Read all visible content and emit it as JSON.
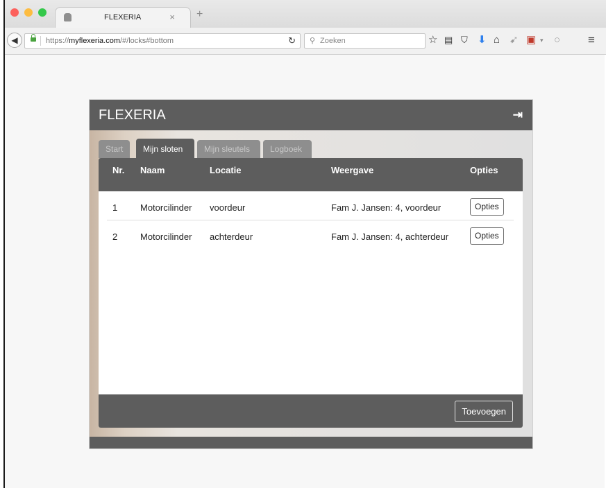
{
  "browser": {
    "tab_title": "FLEXERIA",
    "tab_close": "×",
    "new_tab": "+",
    "url_prefix": "https://",
    "url_domain": "myflexeria.com",
    "url_path": "/#/locks#bottom",
    "search_placeholder": "Zoeken",
    "traffic_light_colors": [
      "#fc605c",
      "#fdbc40",
      "#34c84a"
    ],
    "icons": [
      "back-arrow-icon",
      "lock-icon",
      "reload-icon",
      "search-icon",
      "bookmark-star-icon",
      "reading-list-icon",
      "pocket-icon",
      "download-icon",
      "home-icon",
      "send-icon",
      "extension-icon",
      "chat-icon",
      "menu-icon"
    ]
  },
  "app": {
    "brand": "FLEXERIA",
    "accent": "#5d5d5d",
    "tabs": [
      {
        "label": "Start",
        "active": false
      },
      {
        "label": "Mijn sloten",
        "active": true
      },
      {
        "label": "Mijn sleutels",
        "active": false
      },
      {
        "label": "Logboek",
        "active": false
      }
    ],
    "table": {
      "columns": [
        "Nr.",
        "Naam",
        "Locatie",
        "Weergave",
        "Opties"
      ],
      "rows": [
        {
          "nr": "1",
          "naam": "Motorcilinder",
          "locatie": "voordeur",
          "weergave": "Fam J. Jansen: 4, voordeur",
          "opties": "Opties"
        },
        {
          "nr": "2",
          "naam": "Motorcilinder",
          "locatie": "achterdeur",
          "weergave": "Fam J. Jansen: 4, achterdeur",
          "opties": "Opties"
        }
      ]
    },
    "add_button": "Toevoegen"
  }
}
